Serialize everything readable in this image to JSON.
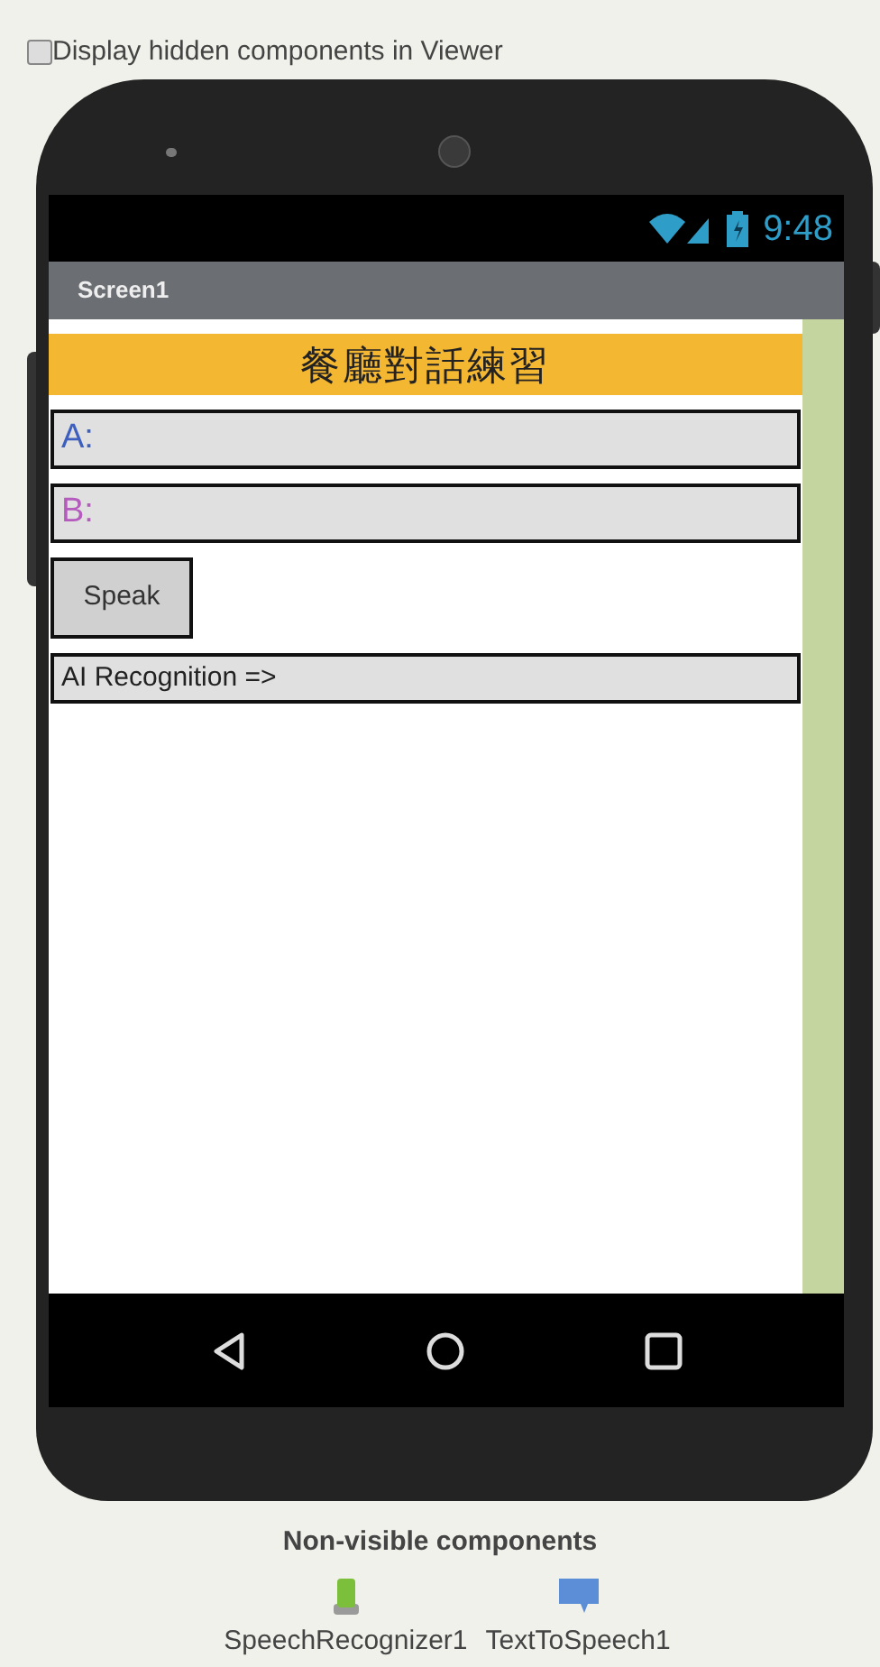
{
  "viewer_option": {
    "label": "Display hidden components in Viewer",
    "checked": false
  },
  "status_bar": {
    "time": "9:48"
  },
  "screen": {
    "title": "Screen1",
    "components": [
      {
        "kind": "banner",
        "text": "餐廳對話練習"
      },
      {
        "kind": "field",
        "text": "A:",
        "color": "#3d5fc0"
      },
      {
        "kind": "field",
        "text": "B:",
        "color": "#b55bbd"
      },
      {
        "kind": "button",
        "text": "Speak"
      },
      {
        "kind": "result",
        "text": "AI Recognition =>"
      }
    ]
  },
  "non_visible": {
    "heading": "Non-visible components",
    "items": [
      {
        "kind": "speech_recognizer",
        "name": "SpeechRecognizer1"
      },
      {
        "kind": "text_to_speech",
        "name": "TextToSpeech1"
      }
    ]
  }
}
